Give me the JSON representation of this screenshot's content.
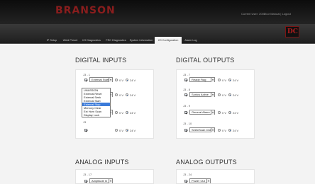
{
  "header": {
    "brand": "BRANSON",
    "user": "Current User: 2002",
    "logout": "Your Manual | Logout"
  },
  "tabs": [
    "IP Setup",
    "Weld Preset",
    "I/O Diagnostics",
    "FRC Diagnostics",
    "System Information",
    "I/O Configuration",
    "Alarm Log"
  ],
  "active_tab": "I/O Configuration",
  "badge": "DC",
  "digital_inputs": {
    "title": "DIGITAL INPUTS",
    "rows": [
      {
        "label": "J3 - 1",
        "value": "External Start"
      },
      {
        "label": "J3 - 2",
        "value": "External Seek"
      },
      {
        "label": "J3 - 3",
        "value": "External Reset"
      },
      {
        "label": "J3",
        "value": ""
      }
    ]
  },
  "digital_outputs": {
    "title": "DIGITAL OUTPUTS",
    "rows": [
      {
        "label": "J3 - 7",
        "value": "Ready Flag"
      },
      {
        "label": "J3 - 8",
        "value": "Sonics Active"
      },
      {
        "label": "J3 - 9",
        "value": "General Alarm"
      },
      {
        "label": "J3 - 10",
        "value": "Seek/Scan Out"
      }
    ]
  },
  "voltage": {
    "v0": "0 V",
    "v24": "24 V"
  },
  "dropdown_options": [
    "UNASSIGN",
    "External Reset",
    "External Seek",
    "External Start",
    "External Stop",
    "Memory Clear",
    "Ext Horn Scan",
    "Display Lock"
  ],
  "dropdown_highlight": "External Stop",
  "analog_inputs": {
    "title": "ANALOG INPUTS",
    "label": "J3 - 17",
    "value": "Amplitude In"
  },
  "analog_outputs": {
    "title": "ANALOG OUTPUTS",
    "label": "J3 - 24",
    "value": "Power Out"
  }
}
